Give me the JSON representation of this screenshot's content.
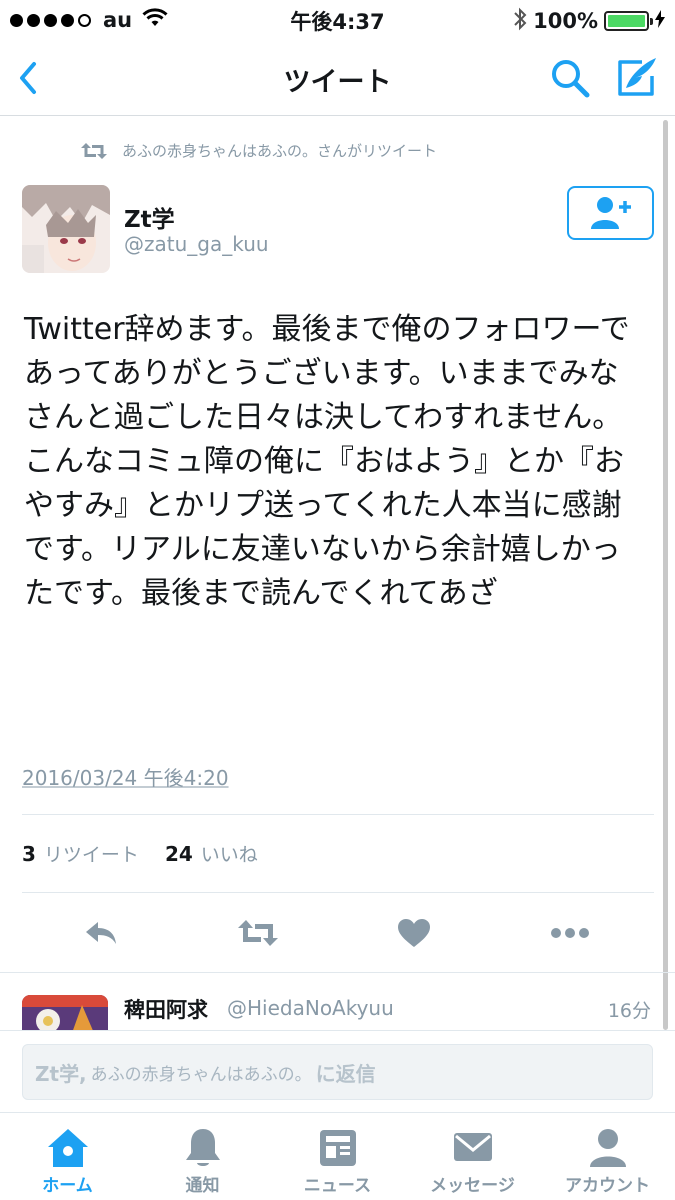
{
  "status_bar": {
    "carrier": "au",
    "time": "午後4:37",
    "battery": "100%",
    "battery_level": 1.0
  },
  "nav": {
    "title": "ツイート",
    "icons": [
      "back-icon",
      "search-icon",
      "compose-icon"
    ]
  },
  "tweet": {
    "retweet_context": "あふの赤身ちゃんはあふの。さんがリツイート",
    "author_name": "Zt学",
    "author_handle": "@zatu_ga_kuu",
    "text": "Twitter辞めます。最後まで俺のフォロワーであってありがとうございます。いままでみなさんと過ごした日々は決してわすれません。こんなコミュ障の俺に『おはよう』とか『おやすみ』とかリプ送ってくれた人本当に感謝です。リアルに友達いないから余計嬉しかったです。最後まで読んでくれてあざ",
    "date": "2016/03/24 午後4:20",
    "retweet_count": "3",
    "retweet_label": "リツイート",
    "like_count": "24",
    "like_label": "いいね"
  },
  "reply_preview": {
    "name": "稗田阿求",
    "handle": "@HiedaNoAkyuu",
    "time": "16分"
  },
  "reply_bar": {
    "prefix_name": "Zt学,",
    "names": "あふの赤身ちゃんはあふの。",
    "suffix": "に返信"
  },
  "tabs": [
    {
      "label": "ホーム",
      "icon": "home-icon",
      "active": true
    },
    {
      "label": "通知",
      "icon": "bell-icon",
      "active": false
    },
    {
      "label": "ニュース",
      "icon": "news-icon",
      "active": false
    },
    {
      "label": "メッセージ",
      "icon": "envelope-icon",
      "active": false
    },
    {
      "label": "アカウント",
      "icon": "person-icon",
      "active": false
    }
  ],
  "colors": {
    "accent": "#1da1f2",
    "icon_gray": "#8899a6",
    "battery_green": "#4cd964"
  }
}
